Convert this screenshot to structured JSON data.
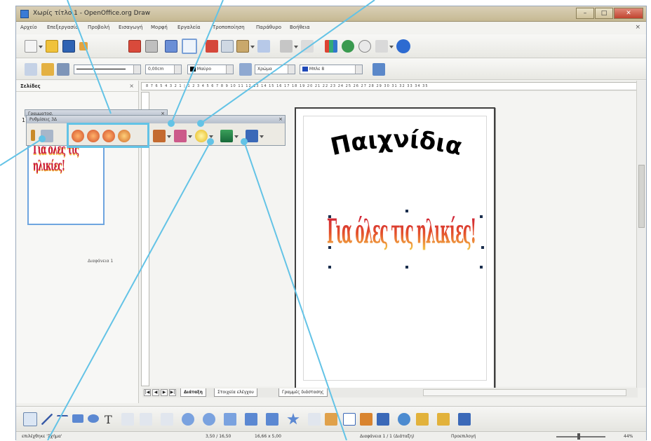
{
  "window": {
    "title": "Χωρίς τίτλο 1 - OpenOffice.org Draw",
    "buttons": {
      "minimize": "–",
      "maximize": "□",
      "close": "✕"
    }
  },
  "menu": [
    "Αρχείο",
    "Επεξεργασία",
    "Προβολή",
    "Εισαγωγή",
    "Μορφή",
    "Εργαλεία",
    "Τροποποίηση",
    "Παράθυρο",
    "Βοήθεια"
  ],
  "line_toolbar": {
    "line_width": "0,00cm",
    "line_color": "Μαύρο",
    "area_style": "Χρώμα",
    "area_color": "Μπλε 8"
  },
  "slides_pane": {
    "title": "Σελίδες",
    "close": "×",
    "page_number": "1",
    "thumb_text": "Για όλες τις ηλικίες!",
    "page_label": "Διαφάνεια 1"
  },
  "ruler": {
    "marks": "8 7 6 5 4 3 2 1 | 1 2 3 4 5 6 7 8 9 10 11 12 13 14 15 16 17 18 19 20 21 22 23 24 25 26 27 28 29 30 31 32 33 34 35"
  },
  "floating_toolbars": {
    "format_title": "Γραμματοσ.",
    "settings_title": "Ρυθμίσεις 3Δ",
    "close": "×"
  },
  "canvas": {
    "fontwork_1": "Παιχνίδια",
    "fontwork_2": "Για όλες τις ηλικίες!"
  },
  "sheet_tabs": [
    "Διάταξη",
    "Στοιχεία ελέγχου",
    "Γραμμές διάστασης"
  ],
  "status": {
    "selection": "επιλέχθηκε 'Σχήμα'",
    "position": "3,50 / 16,50",
    "size": "16,66 x 5,00",
    "slide": "Διαφάνεια 1 / 1 (Διάταξη)",
    "template": "Προεπιλογή",
    "zoom": "44%"
  },
  "colors": {
    "callout": "#63c3e6",
    "accent_blue": "#3a7bd5",
    "wordart_top": "#c8143a",
    "wordart_bottom": "#f6d04a"
  }
}
